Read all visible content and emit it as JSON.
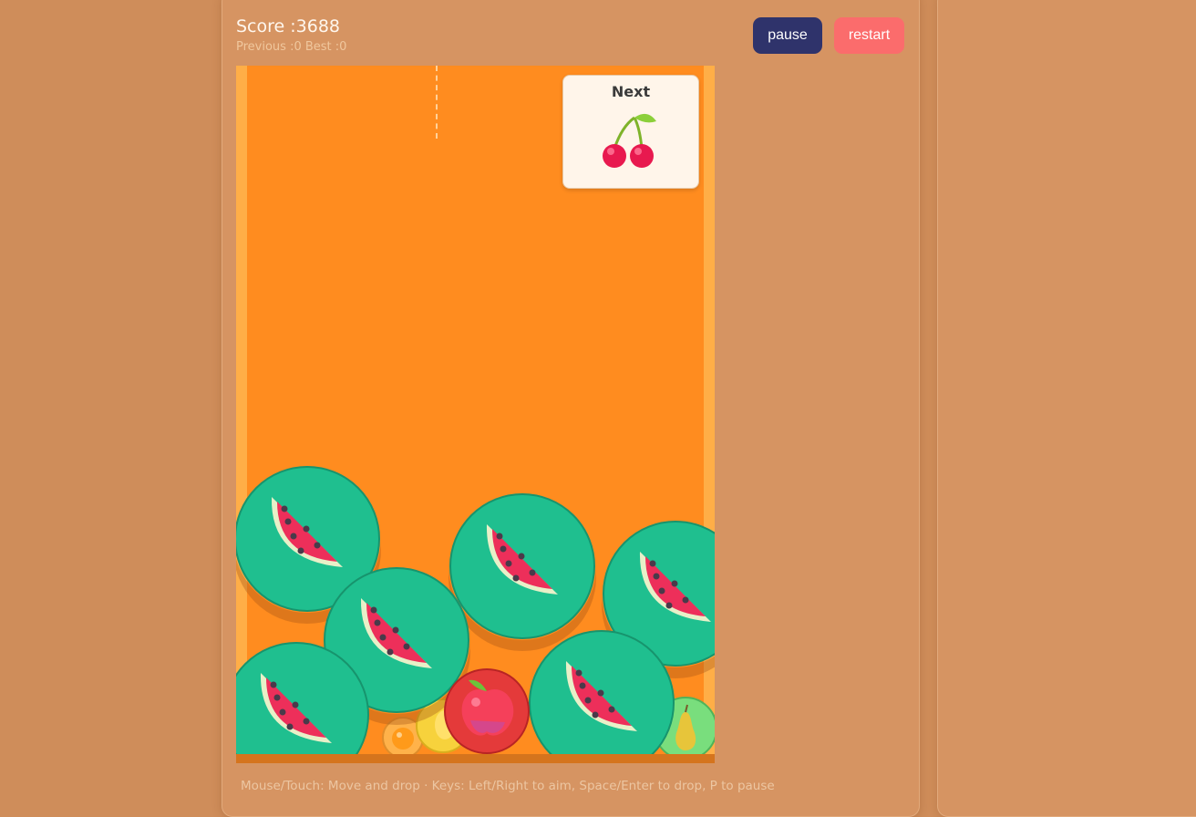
{
  "game": {
    "score_text": "Score :3688",
    "sub_text": "Previous :0 Best :0",
    "next_label": "Next",
    "next_fruit": "cherry-icon",
    "help_text": "Mouse/Touch: Move and drop · Keys: Left/Right to aim, Space/Enter to drop, P to pause"
  },
  "toolbar": {
    "pause_label": "pause",
    "restart_label": "restart"
  },
  "board_fruits": [
    {
      "type": "watermelon",
      "icon": "watermelon-icon"
    },
    {
      "type": "watermelon",
      "icon": "watermelon-icon"
    },
    {
      "type": "watermelon",
      "icon": "watermelon-icon"
    },
    {
      "type": "watermelon",
      "icon": "watermelon-icon"
    },
    {
      "type": "watermelon",
      "icon": "watermelon-icon"
    },
    {
      "type": "watermelon",
      "icon": "watermelon-icon"
    },
    {
      "type": "apple",
      "icon": "apple-icon"
    },
    {
      "type": "lemon",
      "icon": "lemon-icon"
    },
    {
      "type": "orange",
      "icon": "orange-icon"
    },
    {
      "type": "pear",
      "icon": "pear-icon"
    }
  ],
  "colors": {
    "background": "#cf8d5a",
    "board": "#ff8c1f",
    "pause_button": "#2f336b",
    "restart_button": "#fb6c6c",
    "watermelon_bubble": "#1fbf8f"
  }
}
